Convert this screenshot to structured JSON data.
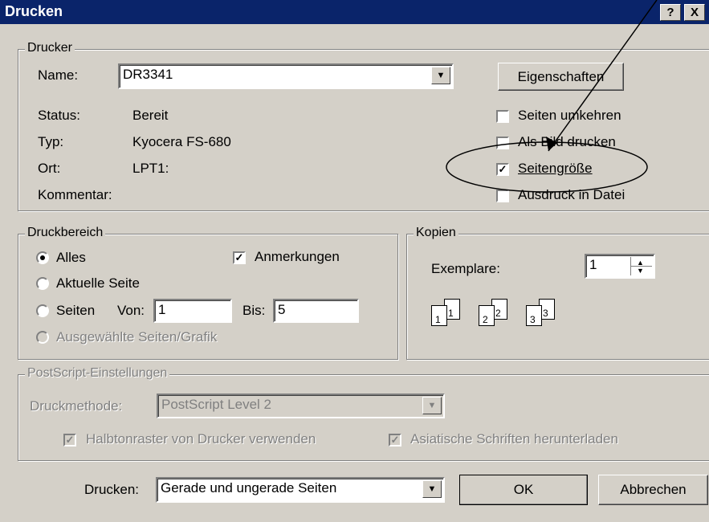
{
  "window": {
    "title": "Drucken",
    "help_label": "?",
    "close_label": "X"
  },
  "printer": {
    "group_label": "Drucker",
    "name_label": "Name:",
    "name_value": "DR3341",
    "properties_button": "Eigenschaften",
    "status_label": "Status:",
    "status_value": "Bereit",
    "type_label": "Typ:",
    "type_value": "Kyocera FS-680",
    "location_label": "Ort:",
    "location_value": "LPT1:",
    "comment_label": "Kommentar:",
    "comment_value": "",
    "options": [
      {
        "label": "Seiten umkehren",
        "checked": false
      },
      {
        "label": "Als Bild drucken",
        "checked": false
      },
      {
        "label": "Seitengröße",
        "checked": true
      },
      {
        "label": "Ausdruck in Datei",
        "checked": false
      }
    ]
  },
  "range": {
    "group_label": "Druckbereich",
    "all_label": "Alles",
    "current_label": "Aktuelle Seite",
    "pages_label": "Seiten",
    "from_label": "Von:",
    "from_value": "1",
    "to_label": "Bis:",
    "to_value": "5",
    "selection_label": "Ausgewählte Seiten/Grafik",
    "annotations_label": "Anmerkungen",
    "annotations_checked": true
  },
  "copies": {
    "group_label": "Kopien",
    "count_label": "Exemplare:",
    "count_value": "1",
    "collate_labels": [
      "1",
      "1",
      "2",
      "2",
      "3",
      "3"
    ]
  },
  "postscript": {
    "group_label": "PostScript-Einstellungen",
    "method_label": "Druckmethode:",
    "method_value": "PostScript Level 2",
    "halftone_label": "Halbtonraster von Drucker verwenden",
    "asian_label": "Asiatische Schriften herunterladen"
  },
  "footer": {
    "print_label": "Drucken:",
    "print_value": "Gerade und ungerade Seiten",
    "ok_button": "OK",
    "cancel_button": "Abbrechen"
  },
  "colors": {
    "titlebar": "#0a246a",
    "face": "#d4d0c8",
    "disabled": "#808080"
  }
}
